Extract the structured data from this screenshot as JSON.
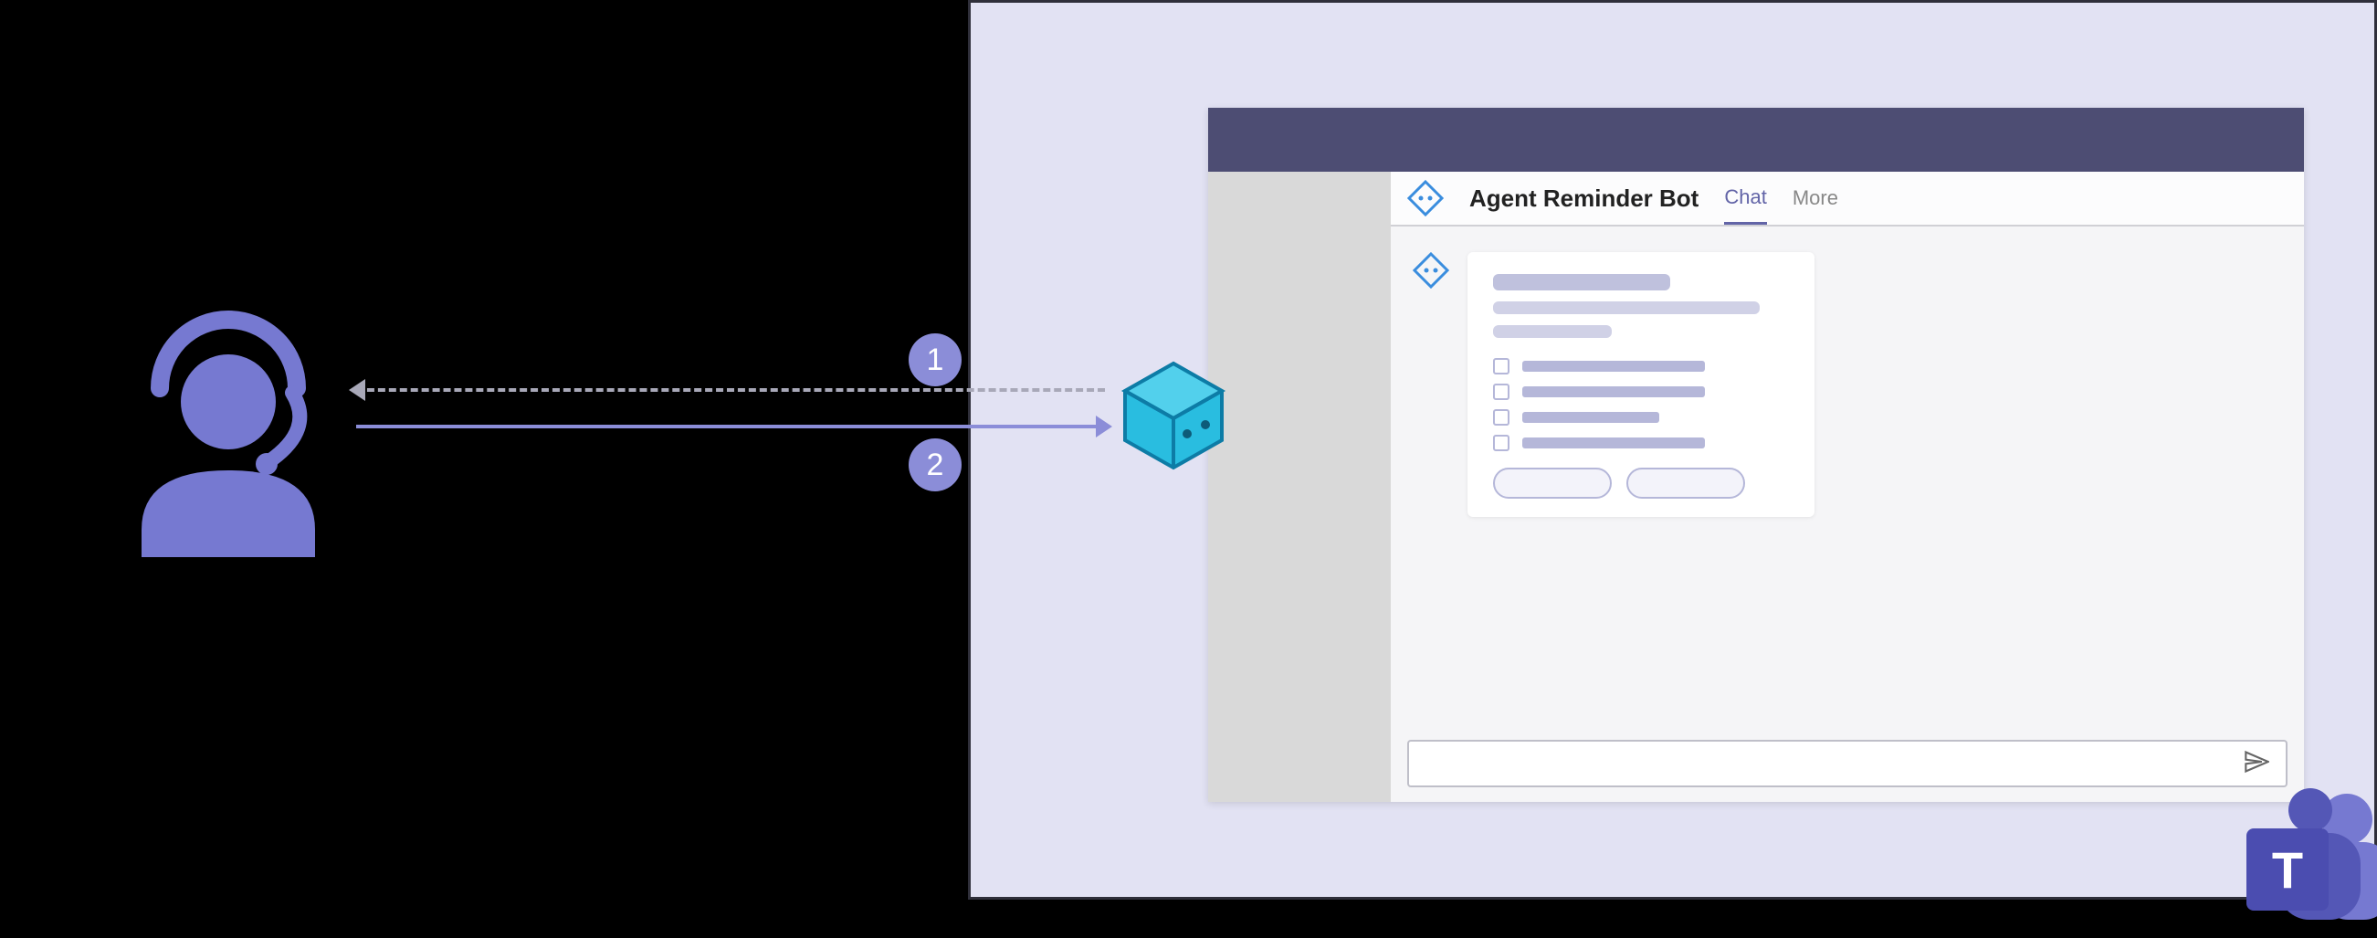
{
  "steps": {
    "one": "1",
    "two": "2"
  },
  "teams": {
    "bot_name": "Agent Reminder Bot",
    "tabs": {
      "chat": "Chat",
      "more": "More"
    },
    "logo_letter": "T"
  },
  "colors": {
    "panel_bg": "#e2e2f3",
    "teams_purple": "#6264a7",
    "titlebar": "#4d4d73",
    "bot_cyan": "#29bde0",
    "agent_purple": "#7679d1"
  },
  "icons": {
    "agent": "headset-agent-icon",
    "bot": "bot-cube-icon",
    "code_avatar": "code-diamond-icon",
    "send": "send-icon",
    "teams_logo": "ms-teams-logo"
  }
}
